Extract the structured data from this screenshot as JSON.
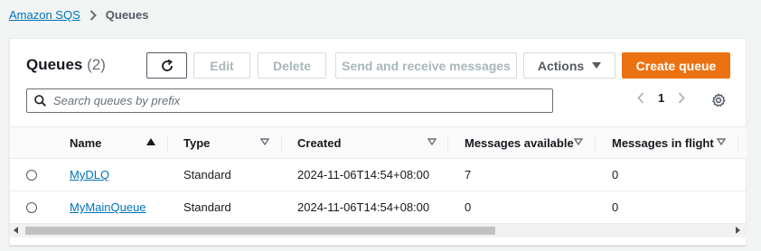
{
  "breadcrumb": {
    "root": "Amazon SQS",
    "separator_icon": "chevron-right-icon",
    "current": "Queues"
  },
  "panel": {
    "title": "Queues",
    "count": "(2)"
  },
  "toolbar": {
    "refresh_icon": "refresh-icon",
    "edit_label": "Edit",
    "delete_label": "Delete",
    "send_label": "Send and receive messages",
    "actions_label": "Actions",
    "create_label": "Create queue"
  },
  "search": {
    "placeholder": "Search queues by prefix",
    "value": ""
  },
  "pagination": {
    "page": "1"
  },
  "table": {
    "columns": [
      "Name",
      "Type",
      "Created",
      "Messages available",
      "Messages in flight"
    ],
    "rows": [
      {
        "name": "MyDLQ",
        "type": "Standard",
        "created": "2024-11-06T14:54+08:00",
        "available": "7",
        "in_flight": "0"
      },
      {
        "name": "MyMainQueue",
        "type": "Standard",
        "created": "2024-11-06T14:54+08:00",
        "available": "0",
        "in_flight": "0"
      }
    ]
  },
  "colors": {
    "accent": "#ec7211",
    "link": "#0073bb"
  }
}
